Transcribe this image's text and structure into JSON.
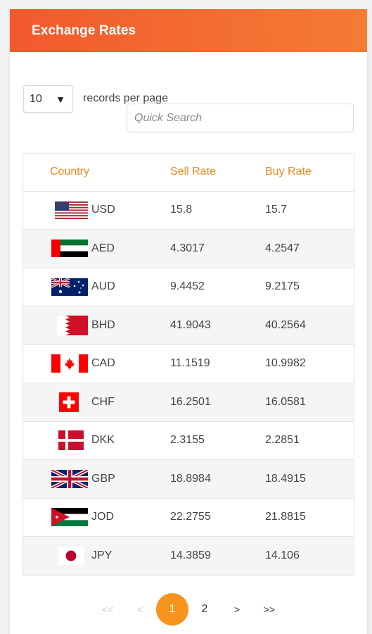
{
  "header": {
    "title": "Exchange Rates"
  },
  "controls": {
    "page_length": "10",
    "page_length_label": "records per page",
    "search_placeholder": "Quick Search"
  },
  "table": {
    "headers": {
      "country": "Country",
      "sell": "Sell Rate",
      "buy": "Buy Rate"
    },
    "rows": [
      {
        "code": "USD",
        "sell": "15.8",
        "buy": "15.7",
        "flag": "us-flag-icon"
      },
      {
        "code": "AED",
        "sell": "4.3017",
        "buy": "4.2547",
        "flag": "uae-flag-icon"
      },
      {
        "code": "AUD",
        "sell": "9.4452",
        "buy": "9.2175",
        "flag": "australia-flag-icon"
      },
      {
        "code": "BHD",
        "sell": "41.9043",
        "buy": "40.2564",
        "flag": "bahrain-flag-icon"
      },
      {
        "code": "CAD",
        "sell": "11.1519",
        "buy": "10.9982",
        "flag": "canada-flag-icon"
      },
      {
        "code": "CHF",
        "sell": "16.2501",
        "buy": "16.0581",
        "flag": "switzerland-flag-icon"
      },
      {
        "code": "DKK",
        "sell": "2.3155",
        "buy": "2.2851",
        "flag": "denmark-flag-icon"
      },
      {
        "code": "GBP",
        "sell": "18.8984",
        "buy": "18.4915",
        "flag": "uk-flag-icon"
      },
      {
        "code": "JOD",
        "sell": "22.2755",
        "buy": "21.8815",
        "flag": "jordan-flag-icon"
      },
      {
        "code": "JPY",
        "sell": "14.3859",
        "buy": "14.106",
        "flag": "japan-flag-icon"
      }
    ]
  },
  "pagination": {
    "first": "<<",
    "prev": "<",
    "page1": "1",
    "page2": "2",
    "next": ">",
    "last": ">>",
    "current": "1"
  },
  "colors": {
    "header_start": "#f2592d",
    "header_end": "#f47c34",
    "column_header": "#f2861e",
    "active_page": "#f7941d"
  }
}
